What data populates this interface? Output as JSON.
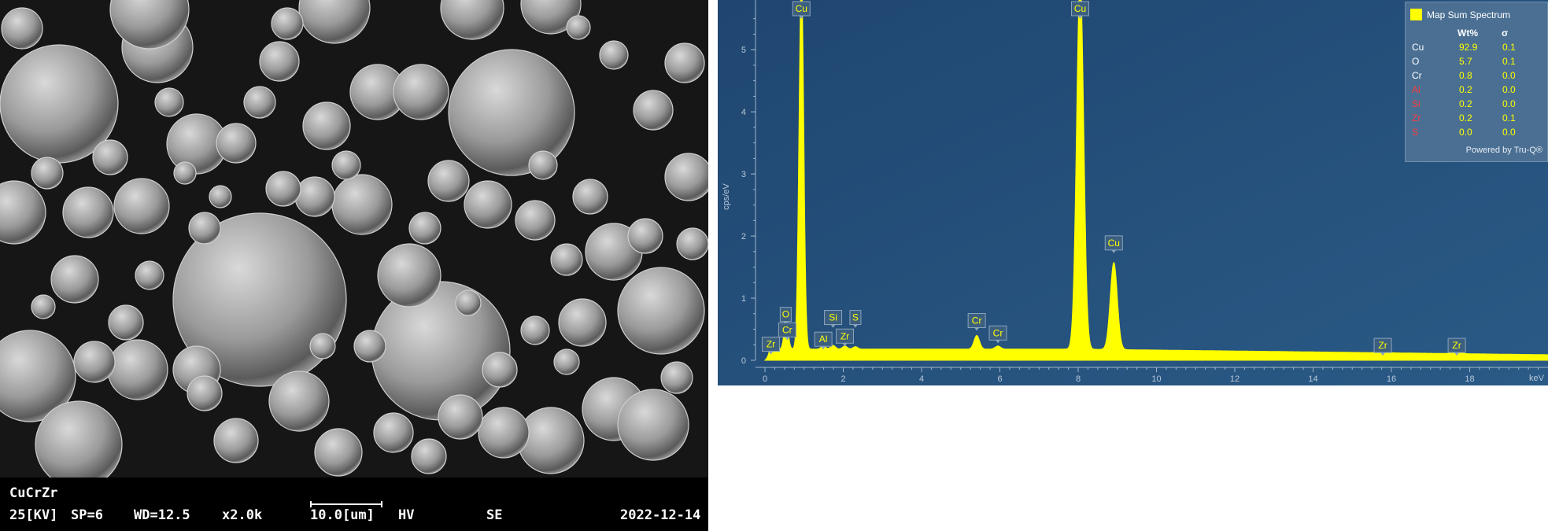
{
  "sem": {
    "sample": "CuCrZr",
    "kv": "25[KV]",
    "sp": "SP=6",
    "wd": "WD=12.5",
    "mag": "x2.0k",
    "scale": "10.0[um]",
    "mode": "HV",
    "detector": "SE",
    "date": "2022-12-14"
  },
  "legend": {
    "title": "Map Sum Spectrum",
    "col_wt": "Wt%",
    "col_sigma": "σ",
    "rows": [
      {
        "el": "Cu",
        "wt": "92.9",
        "sigma": "0.1",
        "color": "#ffffff"
      },
      {
        "el": "O",
        "wt": "5.7",
        "sigma": "0.1",
        "color": "#ffffff"
      },
      {
        "el": "Cr",
        "wt": "0.8",
        "sigma": "0.0",
        "color": "#ffffff"
      },
      {
        "el": "Al",
        "wt": "0.2",
        "sigma": "0.0",
        "color": "#ff3b3b"
      },
      {
        "el": "Si",
        "wt": "0.2",
        "sigma": "0.0",
        "color": "#ff3b3b"
      },
      {
        "el": "Zr",
        "wt": "0.2",
        "sigma": "0.1",
        "color": "#ff3b3b"
      },
      {
        "el": "S",
        "wt": "0.0",
        "sigma": "0.0",
        "color": "#ff3b3b"
      }
    ],
    "powered": "Powered by Tru-Q®"
  },
  "chart_data": {
    "type": "area",
    "ylabel": "cps/eV",
    "xlabel": "keV",
    "xlim": [
      0,
      20
    ],
    "ylim": [
      0,
      5.8
    ],
    "xticks": [
      0,
      2,
      4,
      6,
      8,
      10,
      12,
      14,
      16,
      18
    ],
    "yticks": [
      0,
      1,
      2,
      3,
      4,
      5
    ],
    "series": [
      {
        "color": "#ffff00",
        "background": 0.18,
        "peaks": [
          {
            "x": 0.15,
            "h": 0.12,
            "w": 0.04
          },
          {
            "x": 0.53,
            "h": 0.35,
            "w": 0.05
          },
          {
            "x": 0.57,
            "h": 0.15,
            "w": 0.05
          },
          {
            "x": 0.93,
            "h": 6.0,
            "w": 0.06
          },
          {
            "x": 1.49,
            "h": 0.05,
            "w": 0.06
          },
          {
            "x": 1.74,
            "h": 0.06,
            "w": 0.06
          },
          {
            "x": 2.04,
            "h": 0.05,
            "w": 0.06
          },
          {
            "x": 2.31,
            "h": 0.04,
            "w": 0.06
          },
          {
            "x": 5.41,
            "h": 0.22,
            "w": 0.07
          },
          {
            "x": 5.95,
            "h": 0.05,
            "w": 0.07
          },
          {
            "x": 8.05,
            "h": 6.0,
            "w": 0.09
          },
          {
            "x": 8.91,
            "h": 1.4,
            "w": 0.09
          },
          {
            "x": 15.78,
            "h": 0.02,
            "w": 0.12
          },
          {
            "x": 17.67,
            "h": 0.02,
            "w": 0.12
          }
        ]
      }
    ],
    "labels": [
      {
        "text": "Zr",
        "x": 0.15,
        "level": 0.12
      },
      {
        "text": "O",
        "x": 0.53,
        "level": 0.6
      },
      {
        "text": "Cr",
        "x": 0.57,
        "level": 0.35
      },
      {
        "text": "Cu",
        "x": 0.93,
        "level": 5.7
      },
      {
        "text": "Al",
        "x": 1.49,
        "level": 0.2
      },
      {
        "text": "Si",
        "x": 1.74,
        "level": 0.55
      },
      {
        "text": "Zr",
        "x": 2.04,
        "level": 0.25
      },
      {
        "text": "S",
        "x": 2.31,
        "level": 0.55
      },
      {
        "text": "Cr",
        "x": 5.41,
        "level": 0.5
      },
      {
        "text": "Cr",
        "x": 5.95,
        "level": 0.3
      },
      {
        "text": "Cu",
        "x": 8.05,
        "level": 5.7
      },
      {
        "text": "Cu",
        "x": 8.91,
        "level": 1.75
      },
      {
        "text": "Zr",
        "x": 15.78,
        "level": 0.1
      },
      {
        "text": "Zr",
        "x": 17.67,
        "level": 0.1
      }
    ]
  }
}
